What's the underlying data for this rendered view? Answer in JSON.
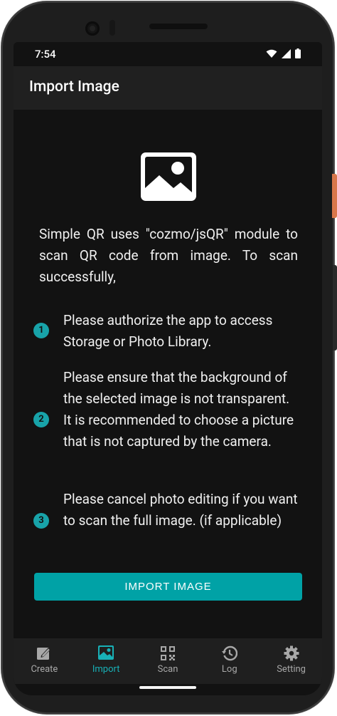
{
  "status_bar": {
    "time": "7:54"
  },
  "app_bar": {
    "title": "Import Image"
  },
  "intro": "Simple QR uses \"cozmo/jsQR\" module to scan QR code from image. To scan successfully,",
  "steps": [
    {
      "number": "1",
      "text": "Please authorize the app to access Storage or Photo Library."
    },
    {
      "number": "2",
      "text": "Please ensure that the background of the selected image is not transparent. It is recommended to choose a picture that is not captured by the camera."
    },
    {
      "number": "3",
      "text": "Please cancel photo editing if you want to scan the full image. (if applicable)"
    }
  ],
  "import_button": {
    "label": "IMPORT IMAGE"
  },
  "tabs": [
    {
      "label": "Create",
      "icon": "edit-square-icon",
      "active": false
    },
    {
      "label": "Import",
      "icon": "image-icon",
      "active": true
    },
    {
      "label": "Scan",
      "icon": "qr-scan-icon",
      "active": false
    },
    {
      "label": "Log",
      "icon": "history-icon",
      "active": false
    },
    {
      "label": "Setting",
      "icon": "gear-icon",
      "active": false
    }
  ],
  "colors": {
    "accent": "#18a3a9",
    "button": "#00a2a6",
    "background": "#121212",
    "app_bar": "#202020"
  }
}
